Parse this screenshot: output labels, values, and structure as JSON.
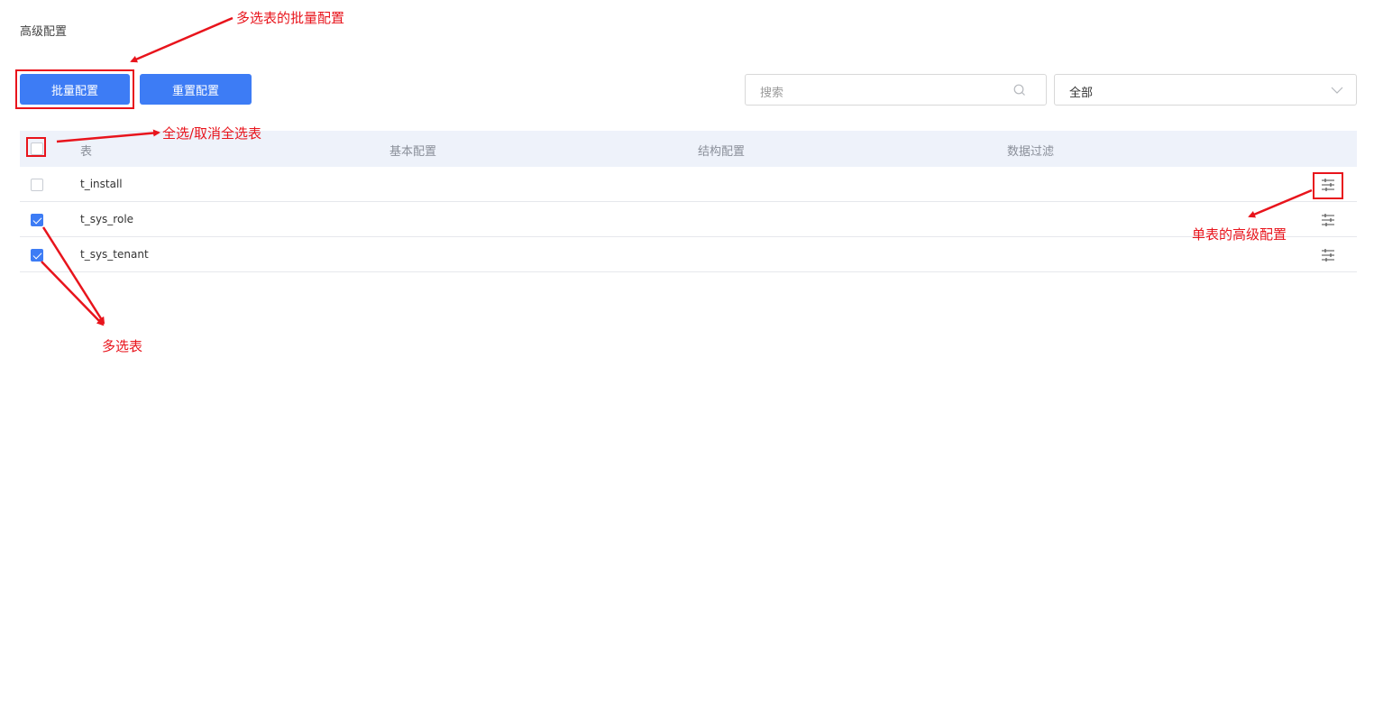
{
  "page_title": "高级配置",
  "toolbar": {
    "batch_label": "批量配置",
    "reset_label": "重置配置",
    "search_placeholder": "搜索",
    "filter_value": "全部"
  },
  "table": {
    "headers": [
      "表",
      "基本配置",
      "结构配置",
      "数据过滤"
    ],
    "rows": [
      {
        "name": "t_install",
        "checked": false
      },
      {
        "name": "t_sys_role",
        "checked": true
      },
      {
        "name": "t_sys_tenant",
        "checked": true
      }
    ]
  },
  "annotations": {
    "batch_config": "多选表的批量配置",
    "select_all": "全选/取消全选表",
    "multi_select": "多选表",
    "single_config": "单表的高级配置"
  },
  "colors": {
    "primary": "#3d7cf5",
    "annotation": "#e8141c",
    "header_bg": "#eef2fa"
  }
}
